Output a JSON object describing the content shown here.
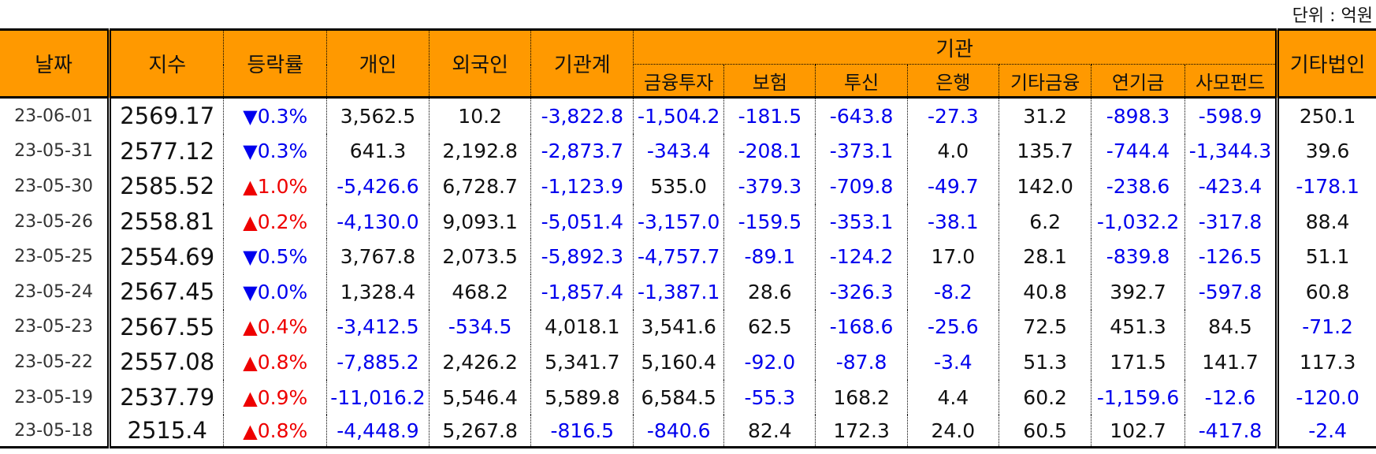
{
  "unit_label": "단위 : 억원",
  "headers": {
    "date": "날짜",
    "index": "지수",
    "change": "등락률",
    "individual": "개인",
    "foreign": "외국인",
    "institution_total": "기관계",
    "institution_group": "기관",
    "financial_investment": "금융투자",
    "insurance": "보험",
    "investment_trust": "투신",
    "bank": "은행",
    "other_financial": "기타금융",
    "pension": "연기금",
    "private_fund": "사모펀드",
    "other_corporate": "기타법인"
  },
  "colors": {
    "header_bg": "#ff9900",
    "negative": "#0000ee",
    "up_arrow": "#ee0000",
    "down_arrow": "#0000ee"
  },
  "rows": [
    {
      "date": "23-06-01",
      "index": "2569.17",
      "dir": "down",
      "arrow": "▼",
      "change": "0.3%",
      "individual": "3,562.5",
      "foreign": "10.2",
      "inst_total": "-3,822.8",
      "fin_inv": "-1,504.2",
      "insurance": "-181.5",
      "trust": "-643.8",
      "bank": "-27.3",
      "other_fin": "31.2",
      "pension": "-898.3",
      "private_fund": "-598.9",
      "other_corp": "250.1"
    },
    {
      "date": "23-05-31",
      "index": "2577.12",
      "dir": "down",
      "arrow": "▼",
      "change": "0.3%",
      "individual": "641.3",
      "foreign": "2,192.8",
      "inst_total": "-2,873.7",
      "fin_inv": "-343.4",
      "insurance": "-208.1",
      "trust": "-373.1",
      "bank": "4.0",
      "other_fin": "135.7",
      "pension": "-744.4",
      "private_fund": "-1,344.3",
      "other_corp": "39.6"
    },
    {
      "date": "23-05-30",
      "index": "2585.52",
      "dir": "up",
      "arrow": "▲",
      "change": "1.0%",
      "individual": "-5,426.6",
      "foreign": "6,728.7",
      "inst_total": "-1,123.9",
      "fin_inv": "535.0",
      "insurance": "-379.3",
      "trust": "-709.8",
      "bank": "-49.7",
      "other_fin": "142.0",
      "pension": "-238.6",
      "private_fund": "-423.4",
      "other_corp": "-178.1"
    },
    {
      "date": "23-05-26",
      "index": "2558.81",
      "dir": "up",
      "arrow": "▲",
      "change": "0.2%",
      "individual": "-4,130.0",
      "foreign": "9,093.1",
      "inst_total": "-5,051.4",
      "fin_inv": "-3,157.0",
      "insurance": "-159.5",
      "trust": "-353.1",
      "bank": "-38.1",
      "other_fin": "6.2",
      "pension": "-1,032.2",
      "private_fund": "-317.8",
      "other_corp": "88.4"
    },
    {
      "date": "23-05-25",
      "index": "2554.69",
      "dir": "down",
      "arrow": "▼",
      "change": "0.5%",
      "individual": "3,767.8",
      "foreign": "2,073.5",
      "inst_total": "-5,892.3",
      "fin_inv": "-4,757.7",
      "insurance": "-89.1",
      "trust": "-124.2",
      "bank": "17.0",
      "other_fin": "28.1",
      "pension": "-839.8",
      "private_fund": "-126.5",
      "other_corp": "51.1"
    },
    {
      "date": "23-05-24",
      "index": "2567.45",
      "dir": "down",
      "arrow": "▼",
      "change": "0.0%",
      "individual": "1,328.4",
      "foreign": "468.2",
      "inst_total": "-1,857.4",
      "fin_inv": "-1,387.1",
      "insurance": "28.6",
      "trust": "-326.3",
      "bank": "-8.2",
      "other_fin": "40.8",
      "pension": "392.7",
      "private_fund": "-597.8",
      "other_corp": "60.8"
    },
    {
      "date": "23-05-23",
      "index": "2567.55",
      "dir": "up",
      "arrow": "▲",
      "change": "0.4%",
      "individual": "-3,412.5",
      "foreign": "-534.5",
      "inst_total": "4,018.1",
      "fin_inv": "3,541.6",
      "insurance": "62.5",
      "trust": "-168.6",
      "bank": "-25.6",
      "other_fin": "72.5",
      "pension": "451.3",
      "private_fund": "84.5",
      "other_corp": "-71.2"
    },
    {
      "date": "23-05-22",
      "index": "2557.08",
      "dir": "up",
      "arrow": "▲",
      "change": "0.8%",
      "individual": "-7,885.2",
      "foreign": "2,426.2",
      "inst_total": "5,341.7",
      "fin_inv": "5,160.4",
      "insurance": "-92.0",
      "trust": "-87.8",
      "bank": "-3.4",
      "other_fin": "51.3",
      "pension": "171.5",
      "private_fund": "141.7",
      "other_corp": "117.3"
    },
    {
      "date": "23-05-19",
      "index": "2537.79",
      "dir": "up",
      "arrow": "▲",
      "change": "0.9%",
      "individual": "-11,016.2",
      "foreign": "5,546.4",
      "inst_total": "5,589.8",
      "fin_inv": "6,584.5",
      "insurance": "-55.3",
      "trust": "168.2",
      "bank": "4.4",
      "other_fin": "60.2",
      "pension": "-1,159.6",
      "private_fund": "-12.6",
      "other_corp": "-120.0"
    },
    {
      "date": "23-05-18",
      "index": "2515.4",
      "dir": "up",
      "arrow": "▲",
      "change": "0.8%",
      "individual": "-4,448.9",
      "foreign": "5,267.8",
      "inst_total": "-816.5",
      "fin_inv": "-840.6",
      "insurance": "82.4",
      "trust": "172.3",
      "bank": "24.0",
      "other_fin": "60.5",
      "pension": "102.7",
      "private_fund": "-417.8",
      "other_corp": "-2.4"
    }
  ]
}
